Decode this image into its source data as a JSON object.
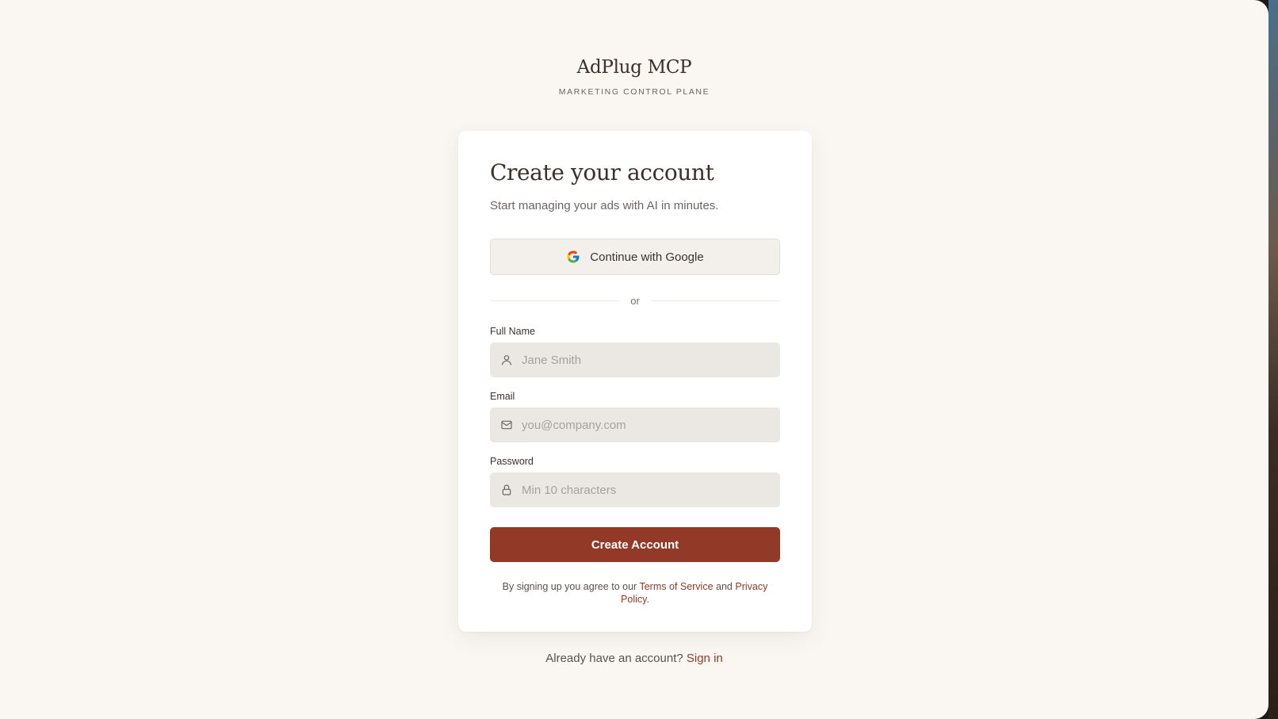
{
  "brand": {
    "title": "AdPlug MCP",
    "subtitle": "MARKETING CONTROL PLANE"
  },
  "card": {
    "title": "Create your account",
    "subtitle": "Start managing your ads with AI in minutes.",
    "google_button_label": "Continue with Google",
    "divider_text": "or",
    "fields": {
      "full_name": {
        "label": "Full Name",
        "placeholder": "Jane Smith",
        "icon": "user-icon"
      },
      "email": {
        "label": "Email",
        "placeholder": "you@company.com",
        "icon": "mail-icon"
      },
      "password": {
        "label": "Password",
        "placeholder": "Min 10 characters",
        "icon": "lock-icon"
      }
    },
    "submit_label": "Create Account",
    "terms": {
      "prefix": "By signing up you agree to our ",
      "terms_link": "Terms of Service",
      "middle": " and ",
      "privacy_link": "Privacy Policy",
      "suffix": "."
    }
  },
  "footer": {
    "prompt": "Already have an account? ",
    "signin_link": "Sign in"
  },
  "colors": {
    "background": "#faf7f3",
    "accent": "#923a27",
    "input_bg": "#ebe8e4",
    "card_bg": "#ffffff"
  }
}
